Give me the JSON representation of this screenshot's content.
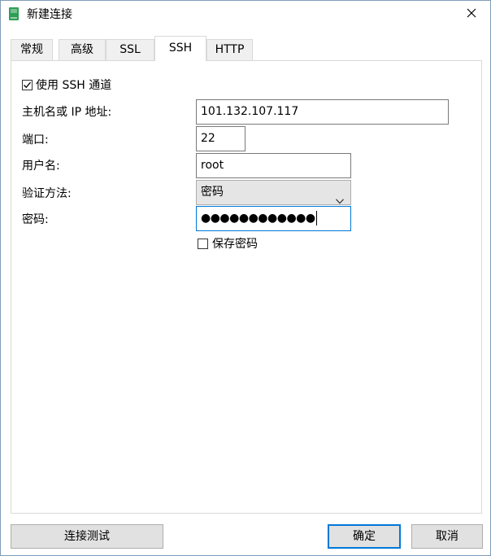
{
  "window": {
    "title": "新建连接",
    "close_glyph": "✕"
  },
  "tabs": [
    {
      "label": "常规",
      "active": false
    },
    {
      "label": "高级",
      "active": false
    },
    {
      "label": "SSL",
      "active": false
    },
    {
      "label": "SSH",
      "active": true
    },
    {
      "label": "HTTP",
      "active": false
    }
  ],
  "ssh": {
    "use_tunnel_label": "使用 SSH 通道",
    "use_tunnel_checked": true,
    "host_label": "主机名或 IP 地址:",
    "host_value": "101.132.107.117",
    "port_label": "端口:",
    "port_value": "22",
    "username_label": "用户名:",
    "username_value": "root",
    "auth_label": "验证方法:",
    "auth_value": "密码",
    "password_label": "密码:",
    "password_masked": "●●●●●●●●●●●●",
    "save_password_label": "保存密码",
    "save_password_checked": false
  },
  "buttons": {
    "test": "连接测试",
    "ok": "确定",
    "cancel": "取消"
  },
  "colors": {
    "accent": "#0078d7",
    "app_icon": "#2e9e54"
  }
}
